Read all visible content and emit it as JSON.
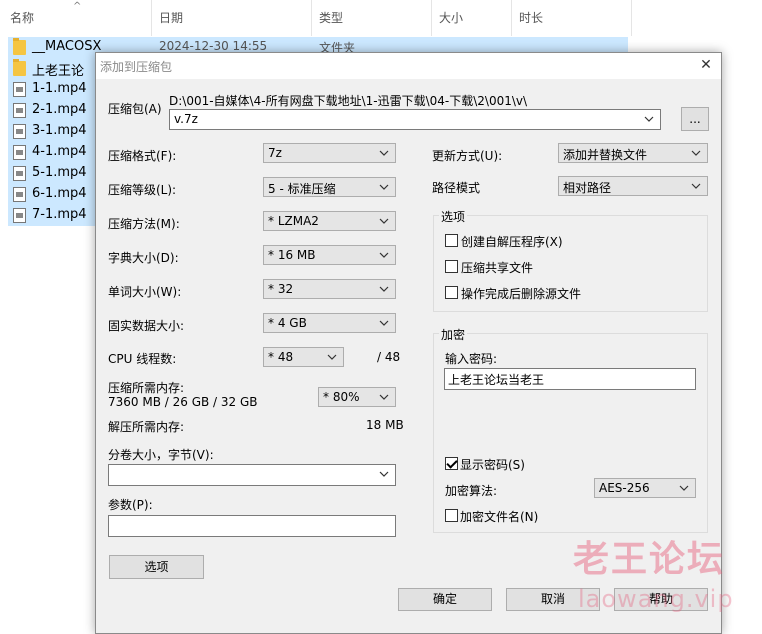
{
  "explorer": {
    "columns": {
      "name": "名称",
      "date": "日期",
      "type": "类型",
      "size": "大小",
      "duration": "时长"
    },
    "files": [
      {
        "name": "__MACOSX",
        "date": "2024-12-30 14:55",
        "type": "文件夹",
        "icon": "folder-icon"
      },
      {
        "name": "上老王论坛当",
        "date": "",
        "type": "",
        "icon": "folder-icon"
      },
      {
        "name": "1-1.mp4",
        "icon": "video-file-icon"
      },
      {
        "name": "2-1.mp4",
        "icon": "video-file-icon"
      },
      {
        "name": "3-1.mp4",
        "icon": "video-file-icon"
      },
      {
        "name": "4-1.mp4",
        "icon": "video-file-icon"
      },
      {
        "name": "5-1.mp4",
        "icon": "video-file-icon"
      },
      {
        "name": "6-1.mp4",
        "icon": "video-file-icon"
      },
      {
        "name": "7-1.mp4",
        "icon": "video-file-icon"
      }
    ]
  },
  "dialog": {
    "title": "添加到压缩包",
    "close": "✕",
    "archive_label": "压缩包(A)",
    "archive_path": "D:\\001-自媒体\\4-所有网盘下载地址\\1-迅雷下载\\04-下载\\2\\001\\v\\",
    "archive_name": "v.7z",
    "browse_label": "...",
    "format_label": "压缩格式(F):",
    "format_value": "7z",
    "level_label": "压缩等级(L):",
    "level_value": "5 - 标准压缩",
    "method_label": "压缩方法(M):",
    "method_value": "* LZMA2",
    "dict_label": "字典大小(D):",
    "dict_value": "* 16 MB",
    "word_label": "单词大小(W):",
    "word_value": "* 32",
    "solid_label": "固实数据大小:",
    "solid_value": "* 4 GB",
    "cpu_label": "CPU 线程数:",
    "cpu_value": "* 48",
    "cpu_total": "/ 48",
    "mem_comp_label": "压缩所需内存:",
    "mem_comp_value": "7360 MB / 26 GB / 32 GB",
    "mem_percent": "* 80%",
    "mem_decomp_label": "解压所需内存:",
    "mem_decomp_value": "18 MB",
    "split_label": "分卷大小，字节(V):",
    "split_value": "",
    "params_label": "参数(P):",
    "params_value": "",
    "options_button": "选项",
    "update_label": "更新方式(U):",
    "update_value": "添加并替换文件",
    "path_label": "路径模式",
    "path_value": "相对路径",
    "options_group": "选项",
    "opt_sfx": "创建自解压程序(X)",
    "opt_shared": "压缩共享文件",
    "opt_delete": "操作完成后删除源文件",
    "encrypt_group": "加密",
    "password_label": "输入密码:",
    "password_value": "上老王论坛当老王",
    "show_password": "显示密码(S)",
    "algo_label": "加密算法:",
    "algo_value": "AES-256",
    "encrypt_names": "加密文件名(N)",
    "ok": "确定",
    "cancel": "取消",
    "help": "帮助"
  },
  "watermark": {
    "cn": "老王论坛",
    "en": "laowang.vip"
  }
}
